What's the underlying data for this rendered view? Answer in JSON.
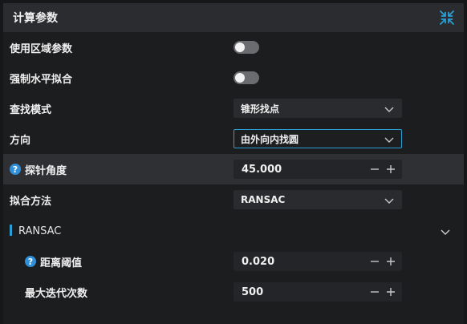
{
  "panel": {
    "title": "计算参数"
  },
  "params": {
    "use_region": {
      "label": "使用区域参数",
      "checked": false
    },
    "force_horizontal": {
      "label": "强制水平拟合",
      "checked": false
    },
    "search_mode": {
      "label": "查找模式",
      "value": "锥形找点"
    },
    "direction": {
      "label": "方向",
      "value": "由外向内找圆"
    },
    "probe_angle": {
      "label": "探针角度",
      "value": "45.000"
    },
    "fit_method": {
      "label": "拟合方法",
      "value": "RANSAC"
    }
  },
  "ransac": {
    "section_title": "RANSAC",
    "distance_threshold": {
      "label": "距离阈值",
      "value": "0.020"
    },
    "max_iterations": {
      "label": "最大迭代次数",
      "value": "500"
    }
  },
  "icons": {
    "collapse": "collapse-icon",
    "help": "help-icon",
    "chevron": "chevron-down-icon",
    "minus": "minus-icon",
    "plus": "plus-icon"
  },
  "colors": {
    "accent": "#2a9fd6",
    "help": "#2f8fd8"
  }
}
